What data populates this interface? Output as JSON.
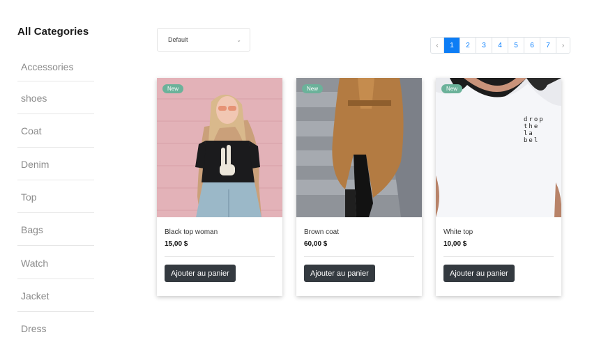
{
  "sidebar": {
    "title": "All Categories",
    "categories": [
      "Accessories",
      "shoes",
      "Coat",
      "Denim",
      "Top",
      "Bags",
      "Watch",
      "Jacket",
      "Dress"
    ]
  },
  "sort": {
    "selected": "Default",
    "chevron_icon": "chevron-down-icon"
  },
  "pagination": {
    "prev": "‹",
    "next": "›",
    "pages": [
      "1",
      "2",
      "3",
      "4",
      "5",
      "6",
      "7"
    ],
    "active_page": "1"
  },
  "products": [
    {
      "badge": "New",
      "name": "Black top woman",
      "price": "15,00 $",
      "button": "Ajouter au panier"
    },
    {
      "badge": "New",
      "name": "Brown coat",
      "price": "60,00 $",
      "button": "Ajouter au panier"
    },
    {
      "badge": "New",
      "name": "White top",
      "price": "10,00 $",
      "button": "Ajouter au panier",
      "print_text": "drop the la bel"
    }
  ],
  "colors": {
    "badge": "#6bb29a",
    "button": "#343a40",
    "active_page": "#0d7df5",
    "link": "#007bff"
  }
}
